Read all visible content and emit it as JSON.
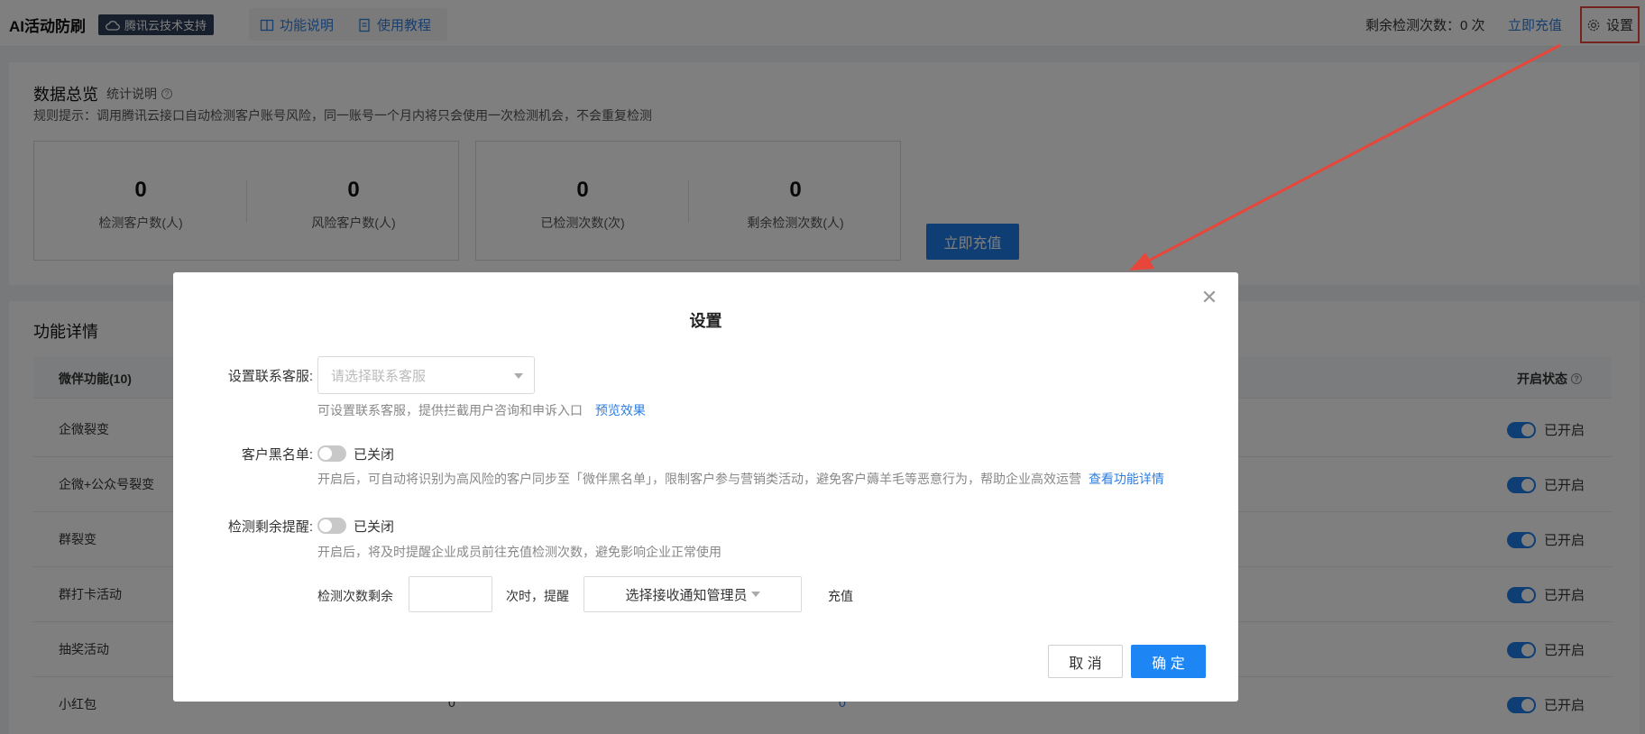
{
  "header": {
    "app_title": "AI活动防刷",
    "badge": "腾讯云技术支持",
    "nav_feature": "功能说明",
    "nav_tutorial": "使用教程",
    "remaining": "剩余检测次数：0 次",
    "recharge_link": "立即充值",
    "settings": "设置"
  },
  "overview": {
    "title": "数据总览",
    "help": "统计说明",
    "rule": "规则提示：调用腾讯云接口自动检测客户账号风险，同一账号一个月内将只会使用一次检测机会，不会重复检测",
    "stats": [
      {
        "value": "0",
        "label": "检测客户数(人)"
      },
      {
        "value": "0",
        "label": "风险客户数(人)"
      },
      {
        "value": "0",
        "label": "已检测次数(次)"
      },
      {
        "value": "0",
        "label": "剩余检测次数(人)"
      }
    ],
    "recharge_button": "立即充值"
  },
  "features": {
    "title": "功能详情",
    "col_name": "微伴功能(10)",
    "col_state": "开启状态",
    "rows": [
      {
        "name": "企微裂变",
        "state": "已开启"
      },
      {
        "name": "企微+公众号裂变",
        "state": "已开启"
      },
      {
        "name": "群裂变",
        "state": "已开启"
      },
      {
        "name": "群打卡活动",
        "state": "已开启"
      },
      {
        "name": "抽奖活动",
        "state": "已开启"
      },
      {
        "name": "小红包",
        "state": "已开启"
      }
    ],
    "last_row_values": [
      "0",
      "0"
    ]
  },
  "modal": {
    "title": "设置",
    "contact_label": "设置联系客服:",
    "contact_placeholder": "请选择联系客服",
    "contact_hint": "可设置联系客服，提供拦截用户咨询和申诉入口",
    "preview_link": "预览效果",
    "blacklist_label": "客户黑名单:",
    "blacklist_state": "已关闭",
    "blacklist_hint": "开启后，可自动将识别为高风险的客户同步至「微伴黑名单」，限制客户参与营销类活动，避免客户薅羊毛等恶意行为，帮助企业高效运营",
    "blacklist_link": "查看功能详情",
    "reminder_label": "检测剩余提醒:",
    "reminder_state": "已关闭",
    "reminder_hint": "开启后，将及时提醒企业成员前往充值检测次数，避免影响企业正常使用",
    "count_prefix": "检测次数剩余",
    "count_mid": "次时，提醒",
    "admin_placeholder": "选择接收通知管理员",
    "count_suffix": "充值",
    "cancel": "取 消",
    "ok": "确 定"
  },
  "colors": {
    "primary": "#1d7ce8",
    "link": "#2f7ee0",
    "highlight": "#e8463a"
  }
}
